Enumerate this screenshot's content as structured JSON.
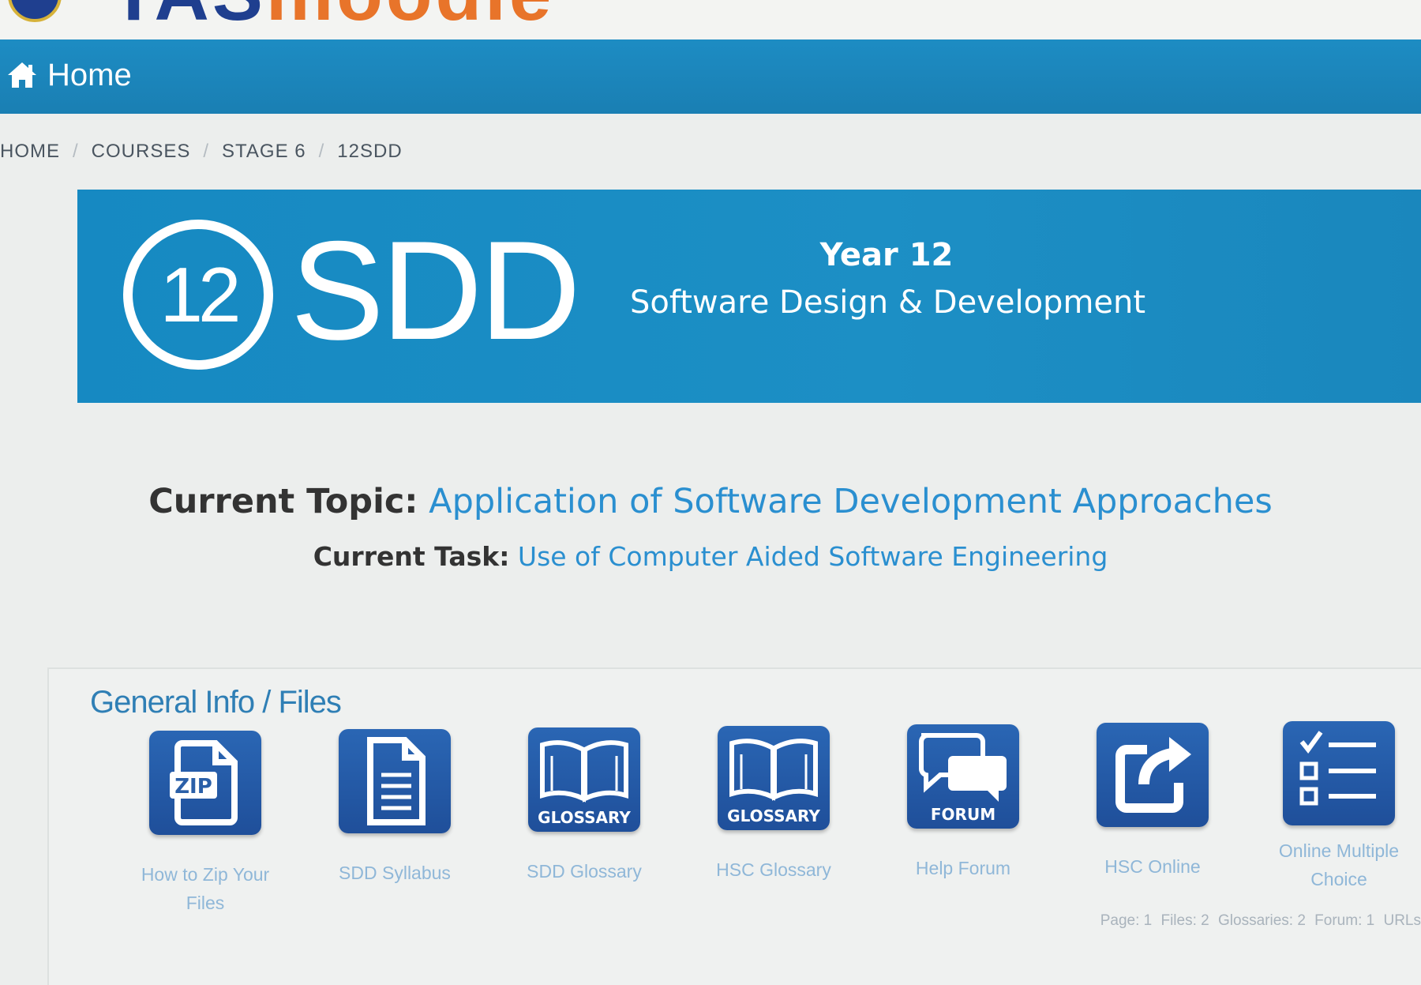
{
  "site": {
    "logo_text_a": "TAS",
    "logo_text_b": "moodle"
  },
  "navbar": {
    "home_label": "Home"
  },
  "breadcrumb": [
    "HOME",
    "COURSES",
    "STAGE 6",
    "12SDD"
  ],
  "banner": {
    "badge_number": "12",
    "course_code": "SDD",
    "year": "Year 12",
    "course_name": "Software Design & Development",
    "background_color": "#1a8cc4"
  },
  "current": {
    "topic_label": "Current Topic:",
    "topic_value": "Application of Software Development Approaches",
    "task_label": "Current Task:",
    "task_value": "Use of Computer Aided Software Engineering"
  },
  "section": {
    "title": "General Info / Files",
    "tiles": [
      {
        "caption": "How to Zip Your Files",
        "icon": "zip-file-icon",
        "icon_word": ""
      },
      {
        "caption": "SDD Syllabus",
        "icon": "document-icon",
        "icon_word": ""
      },
      {
        "caption": "SDD Glossary",
        "icon": "glossary-book-icon",
        "icon_word": "GLOSSARY"
      },
      {
        "caption": "HSC Glossary",
        "icon": "glossary-book-icon",
        "icon_word": "GLOSSARY"
      },
      {
        "caption": "Help Forum",
        "icon": "forum-icon",
        "icon_word": "FORUM"
      },
      {
        "caption": "HSC Online",
        "icon": "external-link-icon",
        "icon_word": ""
      },
      {
        "caption": "Online Multiple Choice",
        "icon": "checklist-icon",
        "icon_word": ""
      }
    ],
    "stats": [
      "Page: 1",
      "Files: 2",
      "Glossaries: 2",
      "Forum: 1",
      "URLs"
    ]
  },
  "colors": {
    "nav": "#1d8cc3",
    "link": "#2a8fd0",
    "tile": "#2a5fa8"
  }
}
